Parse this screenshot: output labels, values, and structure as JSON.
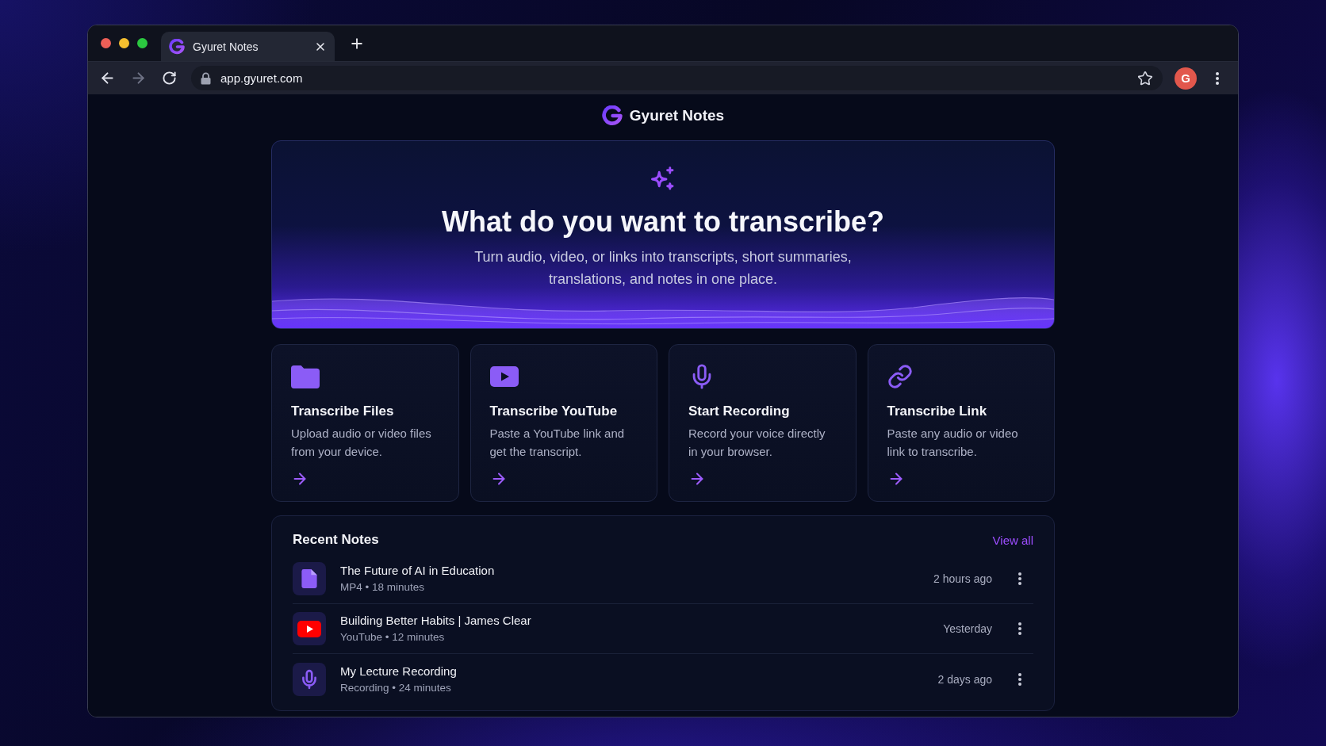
{
  "browser": {
    "tabs": [
      {
        "title": "Gyuret Notes",
        "selected": true
      }
    ],
    "back_disabled": false,
    "forward_disabled": true,
    "address": "app.gyuret.com",
    "profile_initial": "G"
  },
  "app": {
    "name": "Gyuret Notes"
  },
  "hero": {
    "title": "What do you want to transcribe?",
    "subtitle": "Turn audio, video, or links into transcripts, short summaries, translations, and notes in one place."
  },
  "actions": [
    {
      "kind": "files",
      "title": "Transcribe Files",
      "description": "Upload audio or video files from your device."
    },
    {
      "kind": "youtube",
      "title": "Transcribe YouTube",
      "description": "Paste a YouTube link and get the transcript."
    },
    {
      "kind": "recording",
      "title": "Start Recording",
      "description": "Record your voice directly in your browser."
    },
    {
      "kind": "link",
      "title": "Transcribe Link",
      "description": "Paste any audio or video link to transcribe."
    }
  ],
  "recent_notes": {
    "title": "Recent Notes",
    "view_all": "View all",
    "items": [
      {
        "kind": "file",
        "title": "The Future of AI in Education",
        "meta": "MP4 • 18 minutes",
        "time": "2 hours ago"
      },
      {
        "kind": "youtube",
        "title": "Building Better Habits | James Clear",
        "meta": "YouTube • 12 minutes",
        "time": "Yesterday"
      },
      {
        "kind": "recording",
        "title": "My Lecture Recording",
        "meta": "Recording • 24 minutes",
        "time": "2 days ago"
      }
    ]
  }
}
